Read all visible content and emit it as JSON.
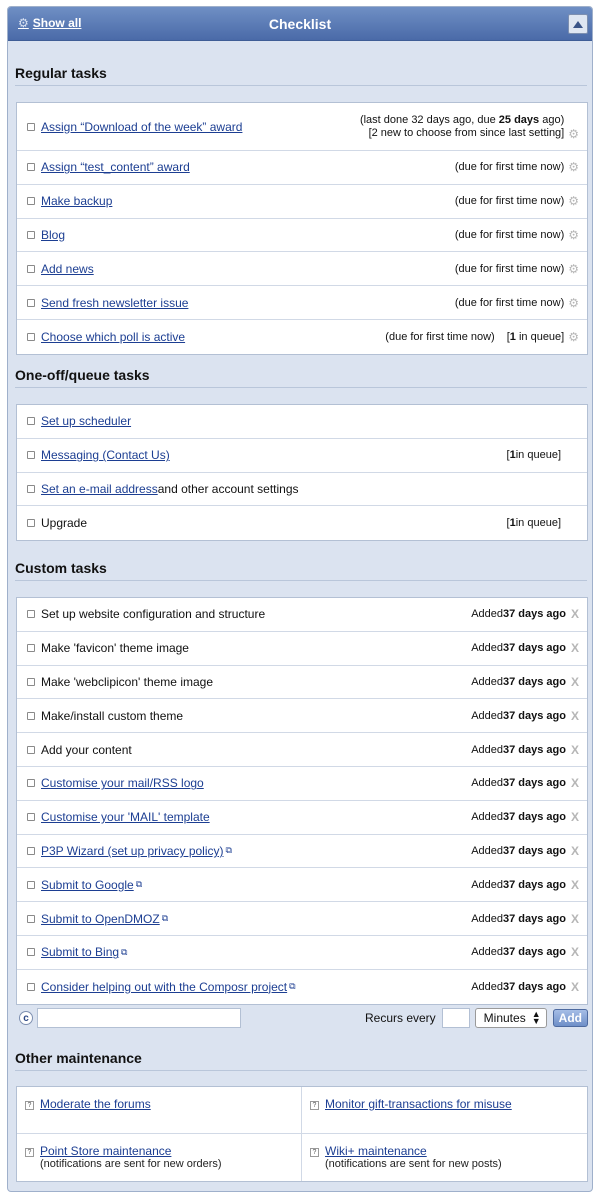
{
  "header": {
    "title": "Checklist",
    "show_all": "Show all"
  },
  "sections": {
    "regular": "Regular tasks",
    "oneoff": "One-off/queue tasks",
    "custom": "Custom tasks",
    "other": "Other maintenance"
  },
  "regular_tasks": [
    {
      "label": "Assign “Download of the week” award",
      "status_pre": "(last done 32 days ago, due ",
      "status_bold": "25 days",
      "status_post": " ago)",
      "status2": "[2 new to choose from since last setting]"
    },
    {
      "label": "Assign “test_content” award",
      "status": "(due for first time now)"
    },
    {
      "label": "Make backup",
      "status": "(due for first time now)"
    },
    {
      "label": "Blog",
      "status": "(due for first time now)"
    },
    {
      "label": "Add news",
      "status": "(due for first time now)"
    },
    {
      "label": "Send fresh newsletter issue",
      "status": "(due for first time now)"
    },
    {
      "label": "Choose which poll is active",
      "status": "(due for first time now)",
      "queue_pre": "[",
      "queue_bold": "1",
      "queue_post": " in queue]"
    }
  ],
  "oneoff_tasks": [
    {
      "label": "Set up scheduler"
    },
    {
      "label": "Messaging (Contact Us)",
      "queue_pre": "[",
      "queue_bold": "1",
      "queue_post": " in queue]"
    },
    {
      "label": "Set an e-mail address",
      "suffix": " and other account settings"
    },
    {
      "label": "Upgrade",
      "queue_pre": "[",
      "queue_bold": "1",
      "queue_post": " in queue]"
    }
  ],
  "custom_added_pre": "Added ",
  "custom_added_bold": "37 days ago",
  "custom_tasks": [
    {
      "label": "Set up website configuration and structure"
    },
    {
      "label": "Make 'favicon' theme image"
    },
    {
      "label": "Make 'webclipicon' theme image"
    },
    {
      "label": "Make/install custom theme"
    },
    {
      "label": "Add your content"
    },
    {
      "label": "Customise your mail/RSS logo"
    },
    {
      "label": "Customise your 'MAIL' template"
    },
    {
      "label": "P3P Wizard (set up privacy policy)"
    },
    {
      "label": "Submit to Google"
    },
    {
      "label": "Submit to OpenDMOZ"
    },
    {
      "label": "Submit to Bing"
    },
    {
      "label": "Consider helping out with the Composr project"
    }
  ],
  "add_form": {
    "recurs_label": "Recurs every",
    "interval_value": "",
    "unit": "Minutes",
    "add_label": "Add",
    "task_value": ""
  },
  "other_maintenance": [
    {
      "label": "Moderate the forums",
      "sub": ""
    },
    {
      "label": "Monitor gift-transactions for misuse",
      "sub": ""
    },
    {
      "label": "Point Store maintenance",
      "sub": "(notifications are sent for new orders)"
    },
    {
      "label": "Wiki+ maintenance",
      "sub": "(notifications are sent for new posts)"
    }
  ]
}
